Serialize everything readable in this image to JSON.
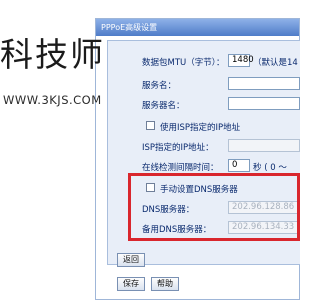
{
  "window": {
    "title": "PPPoE高级设置"
  },
  "watermark": {
    "title": "科技师",
    "url": "WWW.3KJS.COM"
  },
  "form": {
    "mtu": {
      "label": "数据包MTU（字节）：",
      "value": "1480",
      "hint": "（默认是14"
    },
    "service_name": {
      "label": "服务名：",
      "value": ""
    },
    "server_name": {
      "label": "服务器名：",
      "value": ""
    },
    "use_isp_ip": {
      "label": "使用ISP指定的IP地址"
    },
    "isp_ip": {
      "label": "ISP指定的IP地址：",
      "value": ""
    },
    "echo_interval": {
      "label": "在线检测间隔时间：",
      "value": "0",
      "hint": "秒 ( 0 ～"
    },
    "manual_dns": {
      "label": "手动设置DNS服务器"
    },
    "dns": {
      "label": "DNS服务器：",
      "value": "202.96.128.86"
    },
    "dns2": {
      "label": "备用DNS服务器：",
      "value": "202.96.134.33"
    }
  },
  "buttons": {
    "back": "返回",
    "save": "保存",
    "help": "帮助"
  },
  "colors": {
    "highlight_border": "#d9262d",
    "title_bar": "#4f7cc8"
  }
}
